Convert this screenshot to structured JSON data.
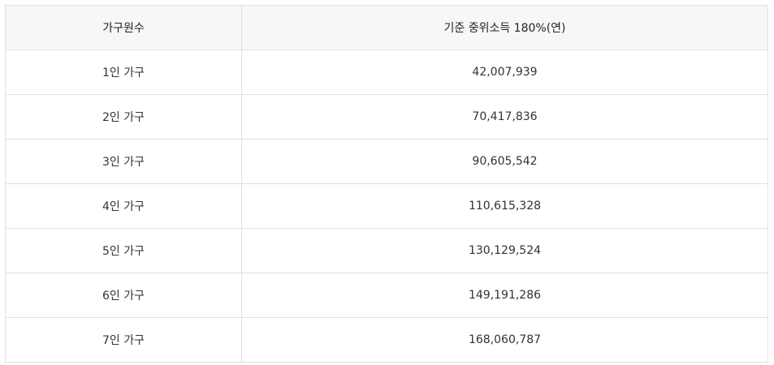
{
  "table": {
    "headers": [
      "가구원수",
      "기준 중위소득 180%(연)"
    ],
    "rows": [
      [
        "1인 가구",
        "42,007,939"
      ],
      [
        "2인 가구",
        "70,417,836"
      ],
      [
        "3인 가구",
        "90,605,542"
      ],
      [
        "4인 가구",
        "110,615,328"
      ],
      [
        "5인 가구",
        "130,129,524"
      ],
      [
        "6인 가구",
        "149,191,286"
      ],
      [
        "7인 가구",
        "168,060,787"
      ]
    ]
  }
}
